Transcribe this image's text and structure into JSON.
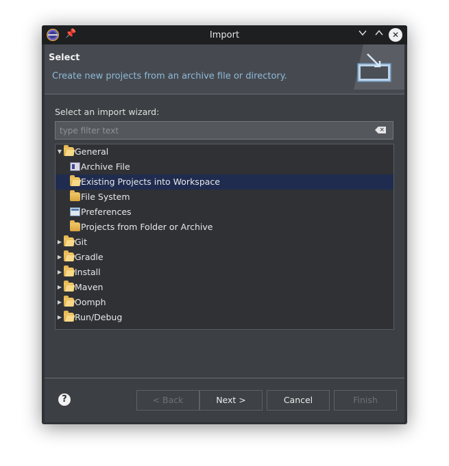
{
  "window": {
    "title": "Import"
  },
  "header": {
    "title": "Select",
    "description": "Create new projects from an archive file or directory."
  },
  "wizard": {
    "label": "Select an import wizard:",
    "filter_placeholder": "type filter text",
    "filter_value": ""
  },
  "tree": {
    "items": [
      {
        "label": "General",
        "expanded": true,
        "icon": "folder-open-icon"
      },
      {
        "label": "Archive File",
        "icon": "archive-file-icon"
      },
      {
        "label": "Existing Projects into Workspace",
        "icon": "projects-folder-icon",
        "selected": true
      },
      {
        "label": "File System",
        "icon": "folder-icon"
      },
      {
        "label": "Preferences",
        "icon": "preferences-icon"
      },
      {
        "label": "Projects from Folder or Archive",
        "icon": "folder-icon"
      },
      {
        "label": "Git",
        "expanded": false,
        "icon": "folder-open-icon"
      },
      {
        "label": "Gradle",
        "expanded": false,
        "icon": "folder-open-icon"
      },
      {
        "label": "Install",
        "expanded": false,
        "icon": "folder-open-icon"
      },
      {
        "label": "Maven",
        "expanded": false,
        "icon": "folder-open-icon"
      },
      {
        "label": "Oomph",
        "expanded": false,
        "icon": "folder-open-icon"
      },
      {
        "label": "Run/Debug",
        "expanded": false,
        "icon": "folder-open-icon"
      }
    ]
  },
  "buttons": {
    "back": "< Back",
    "next": "Next >",
    "cancel": "Cancel",
    "finish": "Finish"
  },
  "colors": {
    "selection": "#1f2c4f",
    "description_text": "#8fb9d8",
    "window_bg": "#3c3f43"
  }
}
